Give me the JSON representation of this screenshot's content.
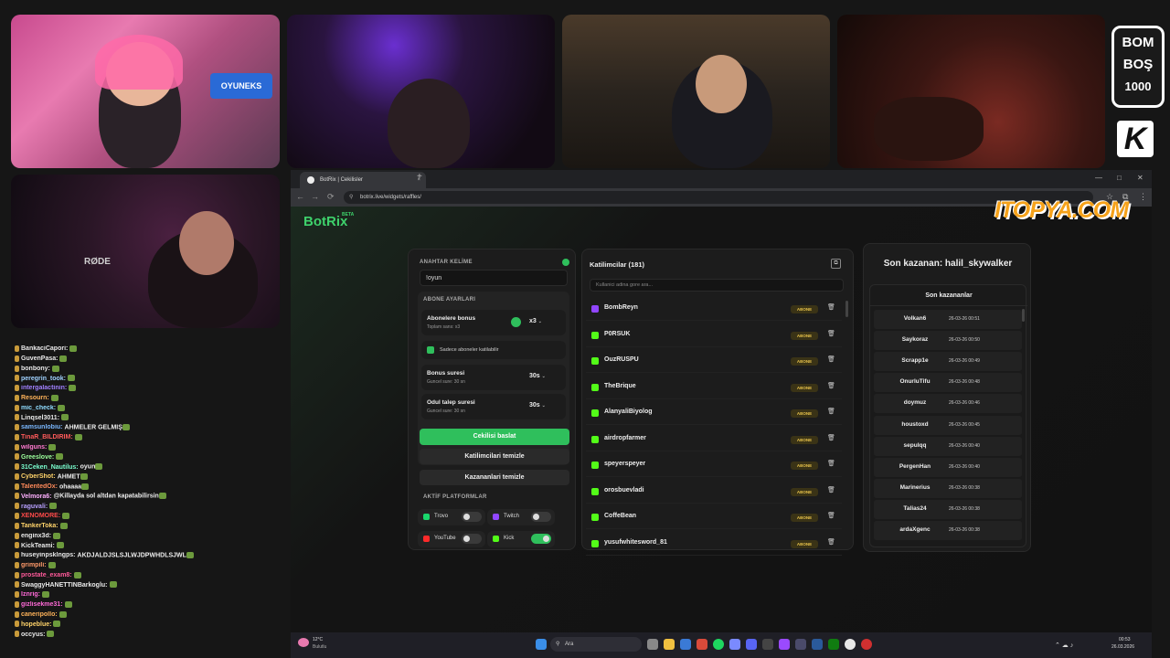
{
  "overlay": {
    "bomb_logo": {
      "line1": "BOM",
      "line2": "BOŞ",
      "line3": "1000"
    },
    "k_logo": "K",
    "cam1_sign": "OYUNEKS",
    "cam5_mic": "RØDE",
    "sponsor": "ITOPYA.COM"
  },
  "chat": [
    {
      "user": "BankaciCapori:",
      "color": "#e9e9e9",
      "msg": ""
    },
    {
      "user": "GuvenPasa:",
      "color": "#e9e9e9",
      "msg": ""
    },
    {
      "user": "bonbony:",
      "color": "#e9e9e9",
      "msg": ""
    },
    {
      "user": "peregrin_took:",
      "color": "#a0d2ff",
      "msg": ""
    },
    {
      "user": "intergalactinin:",
      "color": "#a080ff",
      "msg": ""
    },
    {
      "user": "Resourn:",
      "color": "#ffb35a",
      "msg": ""
    },
    {
      "user": "mic_check:",
      "color": "#8fdcff",
      "msg": ""
    },
    {
      "user": "Linqsel3011:",
      "color": "#e9e9e9",
      "msg": ""
    },
    {
      "user": "samsunlobiu:",
      "color": "#7ab8ff",
      "msg": "AHMELER GELMİŞ"
    },
    {
      "user": "TinaR_BİLDİRİM:",
      "color": "#ff5a5a",
      "msg": ""
    },
    {
      "user": "wilguns:",
      "color": "#ff7ad0",
      "msg": ""
    },
    {
      "user": "Greeslove:",
      "color": "#9cff9c",
      "msg": ""
    },
    {
      "user": "31Ceken_Nautilus:",
      "color": "#7affd0",
      "msg": "oyun"
    },
    {
      "user": "CyberShot:",
      "color": "#ffd36a",
      "msg": "AHMET"
    },
    {
      "user": "TalentedOx:",
      "color": "#ff8a5a",
      "msg": "ohaaaa"
    },
    {
      "user": "Velmora6:",
      "color": "#ffb0ff",
      "msg": "@Killayda sol altdan kapatabilirsin"
    },
    {
      "user": "raguvali:",
      "color": "#b8a0ff",
      "msg": ""
    },
    {
      "user": "XENOMORE:",
      "color": "#ff4a4a",
      "msg": ""
    },
    {
      "user": "TankerToka:",
      "color": "#ffd36a",
      "msg": ""
    },
    {
      "user": "enginx3d:",
      "color": "#e9e9e9",
      "msg": ""
    },
    {
      "user": "KickTeami:",
      "color": "#e9e9e9",
      "msg": ""
    },
    {
      "user": "huseyinpsklngps:",
      "color": "#e9e9e9",
      "msg": "AKDJALDJSLSJLWJDPWHDLSJWL"
    },
    {
      "user": "grimpili:",
      "color": "#ff9a6a",
      "msg": ""
    },
    {
      "user": "prostate_exam8:",
      "color": "#ff5a9a",
      "msg": ""
    },
    {
      "user": "SwaggyHANETTINBarkoglu:",
      "color": "#e9e9e9",
      "msg": ""
    },
    {
      "user": "Iznrig:",
      "color": "#ff6ad8",
      "msg": ""
    },
    {
      "user": "gizlisekme31:",
      "color": "#ff6ad8",
      "msg": ""
    },
    {
      "user": "caneripollo:",
      "color": "#ffb35a",
      "msg": ""
    },
    {
      "user": "hopeblue:",
      "color": "#ffd36a",
      "msg": ""
    },
    {
      "user": "occyus:",
      "color": "#e9e9e9",
      "msg": ""
    }
  ],
  "browser": {
    "tab_title": "BotRix | Cekilisler",
    "url": "botrix.live/widgets/raffles/"
  },
  "app": {
    "brand": "BotRix",
    "beta": "BETA"
  },
  "settings": {
    "keyword_label": "ANAHTAR KELİME",
    "keyword_value": "!oyun",
    "sub_settings_label": "ABONE AYARLARI",
    "sub_bonus_title": "Abonelere bonus",
    "sub_bonus_sub": "Toplam sans: x3",
    "sub_bonus_value": "x3",
    "only_subs": "Sadece aboneler katilabilir",
    "bonus_time_title": "Bonus suresi",
    "bonus_time_sub": "Guncel sure: 30 sn",
    "bonus_time_value": "30s",
    "claim_time_title": "Odul talep suresi",
    "claim_time_sub": "Guncel sure: 30 sn",
    "claim_time_value": "30s",
    "start_btn": "Cekilisi baslat",
    "clear_participants_btn": "Katilimcilari temizle",
    "clear_winners_btn": "Kazananlari temizle",
    "platforms_label": "AKTİF PLATFORMLAR",
    "platforms": [
      {
        "name": "Trovo",
        "color": "#19d66b",
        "on": false
      },
      {
        "name": "Twitch",
        "color": "#9146ff",
        "on": false
      },
      {
        "name": "YouTube",
        "color": "#ff2a2a",
        "on": false
      },
      {
        "name": "Kick",
        "color": "#53fc18",
        "on": true
      }
    ]
  },
  "participants": {
    "title": "Katilimcilar (181)",
    "search_placeholder": "Kullanici adina gore ara...",
    "badge": "ABONE",
    "rows": [
      {
        "name": "BombReyn",
        "platform": "twitch"
      },
      {
        "name": "P0RSUK",
        "platform": "kick"
      },
      {
        "name": "OuzRUSPU",
        "platform": "kick"
      },
      {
        "name": "TheBrique",
        "platform": "kick"
      },
      {
        "name": "AlanyaliBiyolog",
        "platform": "kick"
      },
      {
        "name": "airdropfarmer",
        "platform": "kick"
      },
      {
        "name": "speyerspeyer",
        "platform": "kick"
      },
      {
        "name": "orosbuevladi",
        "platform": "kick"
      },
      {
        "name": "CoffeBean",
        "platform": "kick"
      },
      {
        "name": "yusufwhitesword_81",
        "platform": "kick"
      }
    ]
  },
  "winners": {
    "last_winner": "Son kazanan: halil_skywalker",
    "list_title": "Son kazananlar",
    "rows": [
      {
        "name": "Volkan6",
        "date": "26-03-26 00:51"
      },
      {
        "name": "Saykoraz",
        "date": "26-03-26 00:50"
      },
      {
        "name": "Scrapp1e",
        "date": "26-03-26 00:49"
      },
      {
        "name": "OnurluTifu",
        "date": "26-03-26 00:48"
      },
      {
        "name": "doymuz",
        "date": "26-03-26 00:46"
      },
      {
        "name": "houstoxd",
        "date": "26-03-26 00:45"
      },
      {
        "name": "sepulqq",
        "date": "26-03-26 00:40"
      },
      {
        "name": "PergenHan",
        "date": "26-03-26 00:40"
      },
      {
        "name": "Marinerius",
        "date": "26-03-26 00:38"
      },
      {
        "name": "Talias24",
        "date": "26-03-26 00:38"
      },
      {
        "name": "ardaXgenc",
        "date": "26-03-26 00:38"
      }
    ]
  },
  "taskbar": {
    "weather_temp": "12°C",
    "weather_desc": "Bulutlu",
    "search": "Ara",
    "time": "00:53",
    "date": "26.03.2026"
  }
}
